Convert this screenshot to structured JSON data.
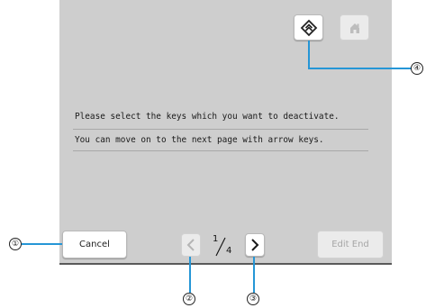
{
  "screen": {
    "message_lines": [
      "Please select the keys which you want to deactivate.",
      "You can move on to the next page with arrow keys."
    ],
    "buttons": {
      "cancel_label": "Cancel",
      "edit_end_label": "Edit End"
    },
    "pager": {
      "current": "1",
      "total": "4"
    },
    "top_icons": [
      "layers-icon",
      "home-icon"
    ]
  },
  "callouts": [
    "①",
    "②",
    "③",
    "④"
  ],
  "colors": {
    "screen_background": "#cecece",
    "button_background": "#ffffff",
    "disabled_button": "#ebebeb",
    "callout_line": "#2596d6"
  }
}
